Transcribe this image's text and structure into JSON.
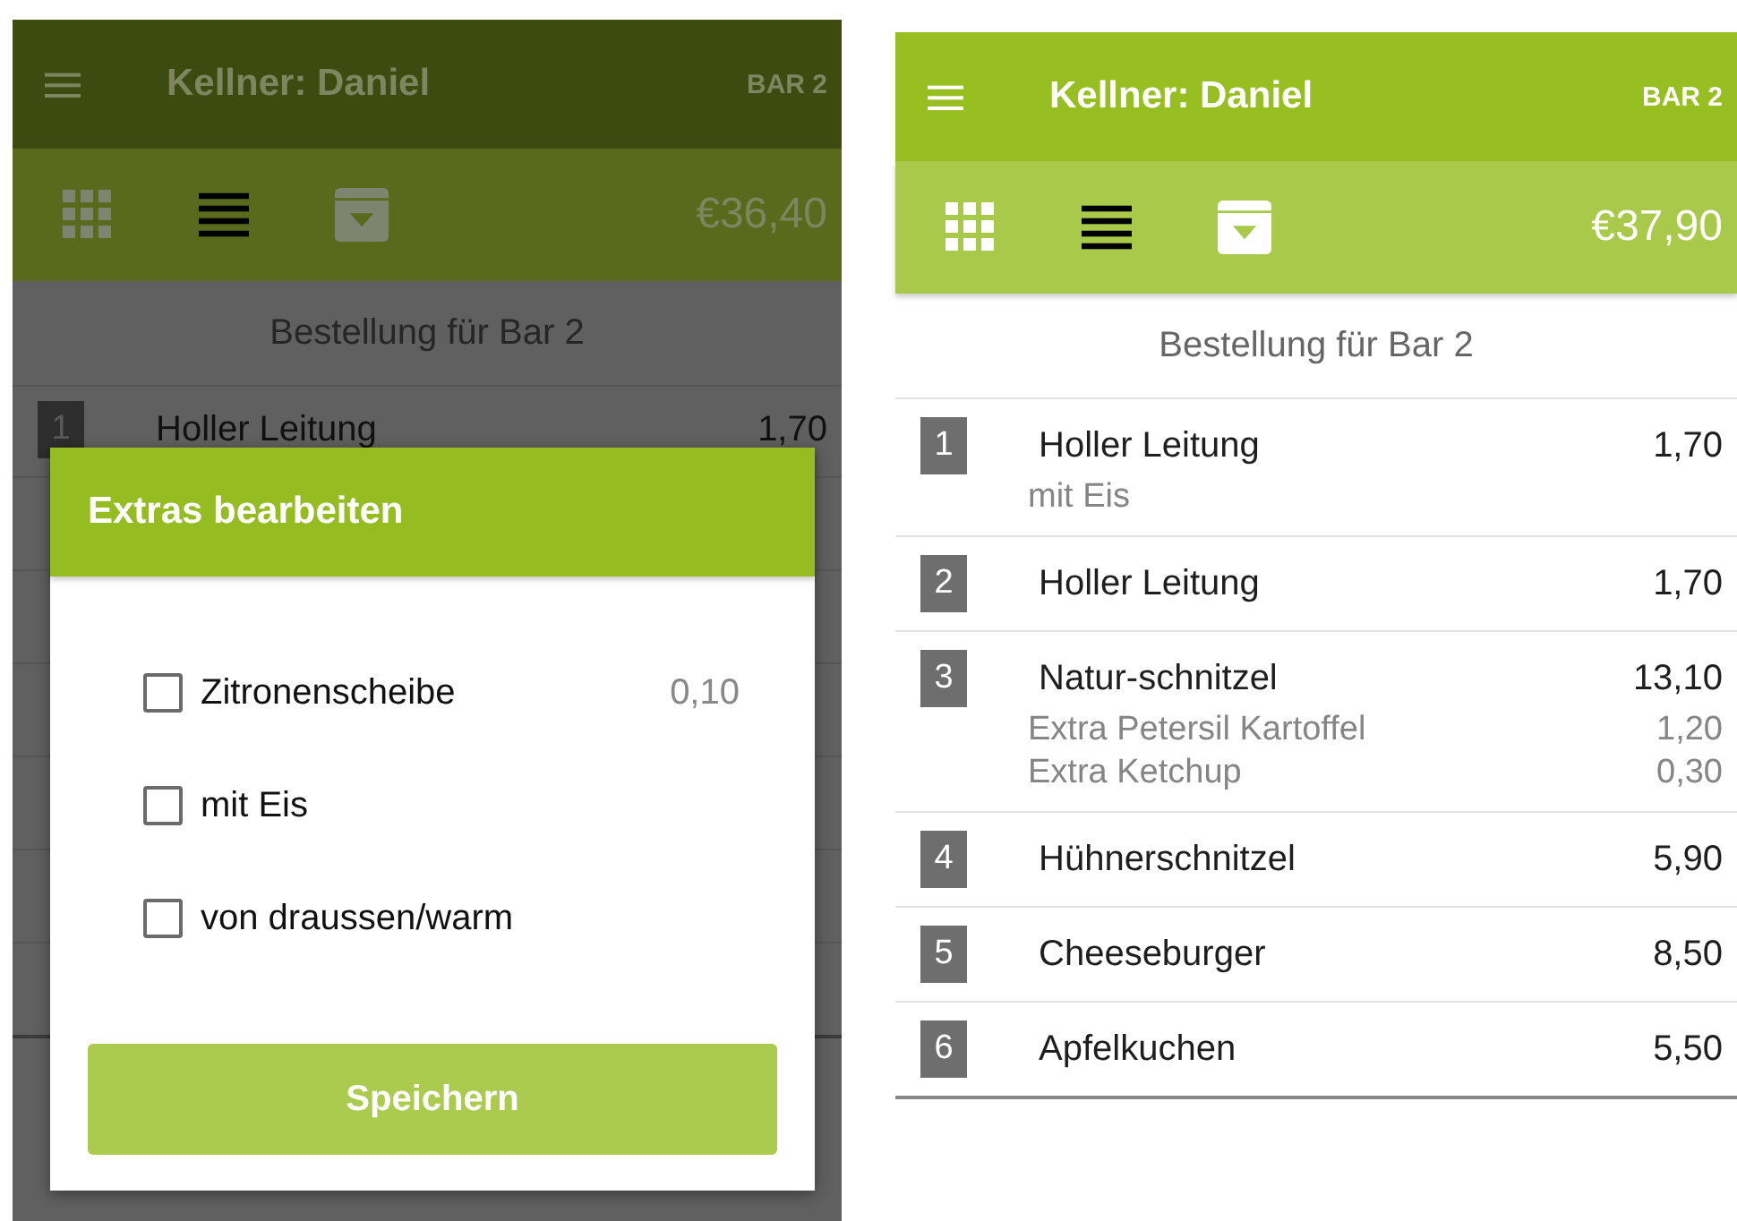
{
  "screens": [
    {
      "dimmed": true,
      "header": {
        "title": "Kellner: Daniel",
        "table": "BAR 2"
      },
      "toolbar": {
        "views": [
          {
            "selected": false
          },
          {
            "selected": true
          }
        ],
        "total": "€36,40"
      },
      "order_title": "Bestellung für Bar 2",
      "items": [
        {
          "number": "1",
          "name": "Holler Leitung",
          "price": "1,70"
        }
      ],
      "dialog": {
        "title": "Extras bearbeiten",
        "options": [
          {
            "label": "Zitronenscheibe",
            "price": "0,10",
            "checked": false
          },
          {
            "label": "mit Eis",
            "checked": false
          },
          {
            "label": "von draussen/warm",
            "checked": false
          }
        ],
        "button": "Speichern"
      }
    },
    {
      "dimmed": false,
      "header": {
        "title": "Kellner: Daniel",
        "table": "BAR 2"
      },
      "toolbar": {
        "views": [
          {
            "selected": false
          },
          {
            "selected": true
          }
        ],
        "total": "€37,90"
      },
      "order_title": "Bestellung für Bar 2",
      "items": [
        {
          "number": "1",
          "name": "Holler Leitung",
          "price": "1,70",
          "extras": [
            {
              "name": "mit Eis"
            }
          ]
        },
        {
          "number": "2",
          "name": "Holler Leitung",
          "price": "1,70"
        },
        {
          "number": "3",
          "name": "Natur-schnitzel",
          "price": "13,10",
          "extras": [
            {
              "name": "Extra Petersil Kartoffel",
              "price": "1,20"
            },
            {
              "name": "Extra Ketchup",
              "price": "0,30"
            }
          ]
        },
        {
          "number": "4",
          "name": "Hühnerschnitzel",
          "price": "5,90"
        },
        {
          "number": "5",
          "name": "Cheeseburger",
          "price": "8,50"
        },
        {
          "number": "6",
          "name": "Apfelkuchen",
          "price": "5,50"
        }
      ]
    }
  ]
}
